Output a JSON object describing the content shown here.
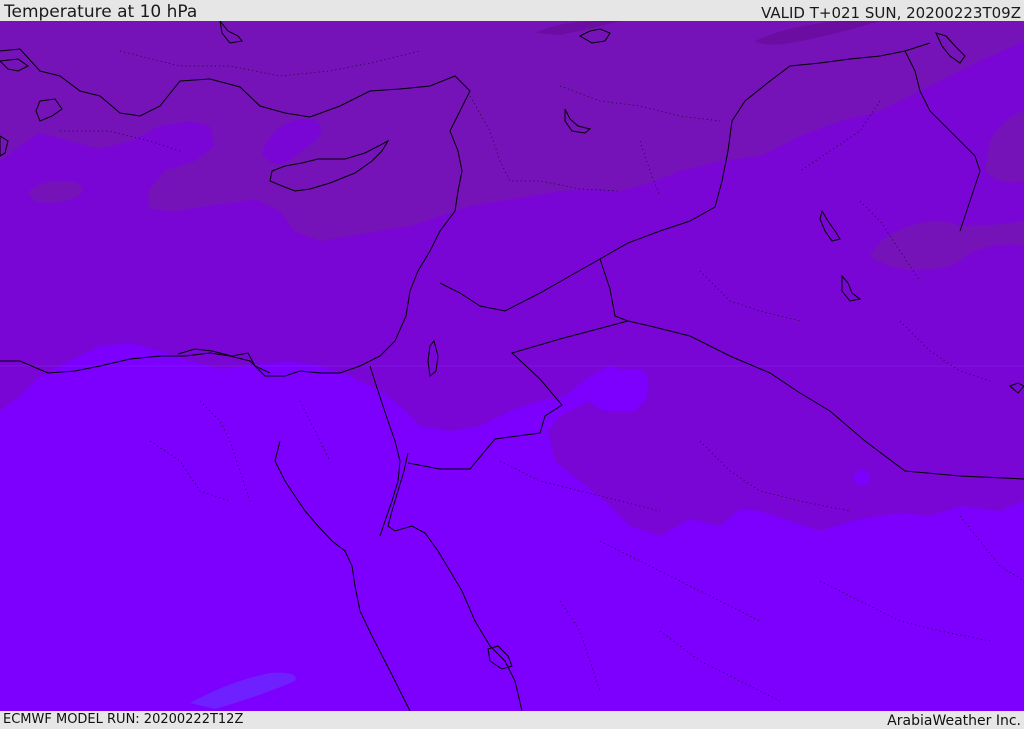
{
  "header": {
    "title": "Temperature at 10 hPa",
    "valid_time": "VALID T+021 SUN, 20200223T09Z"
  },
  "footer": {
    "model_run": "ECMWF MODEL RUN: 20200222T12Z",
    "credit": "ArabiaWeather Inc."
  },
  "colors": {
    "field_cold": "#7d00ff",
    "field_mid": "#7a06d6",
    "field_warm": "#7613b8",
    "field_warmest": "#6a0da0",
    "field_blue": "#6a28ff",
    "coastline": "#000000",
    "bar_background": "#e6e6e6"
  }
}
